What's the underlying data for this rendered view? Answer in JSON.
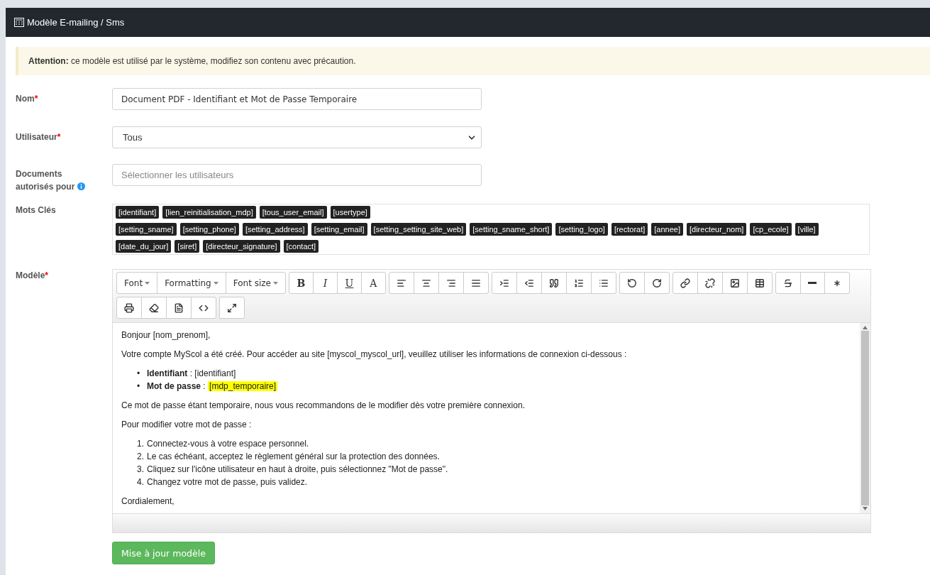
{
  "header": {
    "title": "Modèle E-mailing / Sms"
  },
  "alert": {
    "text": "**Attention:** ce modèle est utilisé par le système, modifiez son contenu avec précaution."
  },
  "form": {
    "name": {
      "label": "Nom",
      "required_mark": "*",
      "value": "Document PDF - Identifiant et Mot de Passe Temporaire"
    },
    "user": {
      "label": "Utilisateur",
      "required_mark": "*",
      "value": "Tous"
    },
    "documents": {
      "label": "Documents autorisés pour",
      "placeholder": "Sélectionner les utilisateurs"
    },
    "keywords": {
      "label": "Mots Clés",
      "tags": [
        "[identifiant]",
        "[lien_reinitialisation_mdp]",
        "[tous_user_email]",
        "[usertype]",
        "[setting_sname]",
        "[setting_phone]",
        "[setting_address]",
        "[setting_email]",
        "[setting_setting_site_web]",
        "[setting_sname_short]",
        "[setting_logo]",
        "[rectorat]",
        "[annee]",
        "[directeur_nom]",
        "[cp_ecole]",
        "[ville]",
        "[date_du_jour]",
        "[siret]",
        "[directeur_signature]",
        "[contact]"
      ]
    },
    "model": {
      "label": "Modèle",
      "required_mark": "*"
    }
  },
  "toolbar": {
    "rows": [
      [
        [
          {
            "kind": "dropdown",
            "label": "Font"
          },
          {
            "kind": "dropdown",
            "label": "Formatting"
          },
          {
            "kind": "dropdown",
            "label": "Font size"
          }
        ],
        [
          {
            "kind": "letter",
            "label": "B"
          },
          {
            "kind": "letter",
            "label": "I"
          },
          {
            "kind": "letter",
            "label": "U"
          },
          {
            "kind": "letter",
            "label": "A"
          }
        ],
        [
          {
            "kind": "icon"
          },
          {
            "kind": "icon"
          },
          {
            "kind": "icon"
          },
          {
            "kind": "icon"
          }
        ],
        [
          {
            "kind": "icon"
          },
          {
            "kind": "icon"
          },
          {
            "kind": "icon"
          },
          {
            "kind": "icon"
          },
          {
            "kind": "icon"
          }
        ],
        [
          {
            "kind": "icon"
          },
          {
            "kind": "icon"
          }
        ],
        [
          {
            "kind": "icon"
          },
          {
            "kind": "icon"
          },
          {
            "kind": "icon"
          },
          {
            "kind": "icon"
          }
        ],
        [
          {
            "kind": "icon"
          },
          {
            "kind": "icon"
          },
          {
            "kind": "icon"
          }
        ]
      ],
      [
        [
          {
            "kind": "icon"
          },
          {
            "kind": "icon"
          },
          {
            "kind": "icon"
          },
          {
            "kind": "icon"
          }
        ],
        [
          {
            "kind": "icon"
          }
        ]
      ]
    ]
  },
  "content": [
    {
      "kind": "p",
      "text": "Bonjour [nom_prenom],"
    },
    {
      "kind": "p",
      "text": "Votre compte MyScol a été créé. Pour accéder au site [myscol_myscol_url], veuillez utiliser les informations de connexion ci-dessous :"
    },
    {
      "kind": "ul",
      "items": [
        {
          "marker": "•",
          "label": "Identifiant",
          "separator": " : ",
          "value": "[identifiant]",
          "highlighted": false
        },
        {
          "marker": "•",
          "label": "Mot de passe",
          "separator": " : ",
          "value": "[mdp_temporaire]",
          "highlighted": true
        }
      ]
    },
    {
      "kind": "p",
      "text": "Ce mot de passe étant temporaire, nous vous recommandons de le modifier dès votre première connexion."
    },
    {
      "kind": "p",
      "text": "Pour modifier votre mot de passe :"
    },
    {
      "kind": "ol",
      "items": [
        {
          "marker": "1.",
          "text": "Connectez-vous à votre espace personnel."
        },
        {
          "marker": "2.",
          "text": "Le cas échéant, acceptez le règlement général sur la protection des données."
        },
        {
          "marker": "3.",
          "text": "Cliquez sur l'icône utilisateur en haut à droite, puis sélectionnez \"Mot de passe\"."
        },
        {
          "marker": "4.",
          "text": "Changez votre mot de passe, puis validez."
        }
      ]
    },
    {
      "kind": "p",
      "text": "Cordialement,"
    }
  ],
  "submit": {
    "label": "Mise à jour modèle"
  }
}
